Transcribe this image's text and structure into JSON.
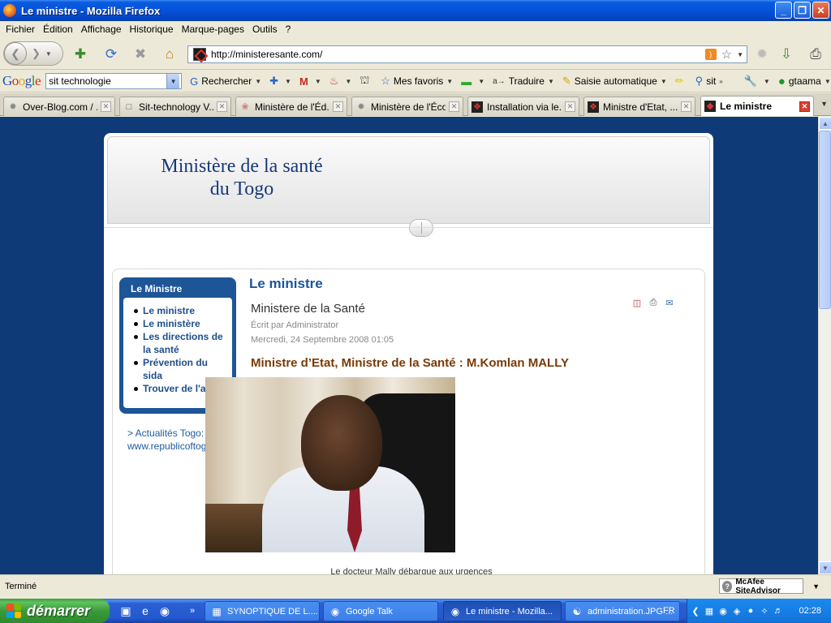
{
  "window": {
    "title": "Le ministre - Mozilla Firefox",
    "minimize": "_",
    "maximize": "❐",
    "close": "✕"
  },
  "menubar": [
    "Fichier",
    "Édition",
    "Affichage",
    "Historique",
    "Marque-pages",
    "Outils",
    "?"
  ],
  "navbar": {
    "url": "http://ministeresante.com/"
  },
  "google_toolbar": {
    "search_value": "sit technologie",
    "items": [
      "Rechercher",
      "Mes favoris",
      "Traduire",
      "Saisie automatique",
      "sit",
      "gtaama"
    ]
  },
  "tabs": [
    {
      "label": "Over-Blog.com / ...",
      "active": false
    },
    {
      "label": "Sit-technology V...",
      "active": false
    },
    {
      "label": "Ministère de l'Éd...",
      "active": false
    },
    {
      "label": "Ministère de l'Éco...",
      "active": false
    },
    {
      "label": "Installation via le...",
      "active": false
    },
    {
      "label": "Ministre d'Etat, ...",
      "active": false
    },
    {
      "label": "Le ministre",
      "active": true
    }
  ],
  "site": {
    "title_line1": "Ministère de la santé",
    "title_line2": "du Togo"
  },
  "sidebar": {
    "title": "Le Ministre",
    "items": [
      "Le ministre",
      "Le ministère",
      "Les directions de la santé",
      "Prévention du sida",
      "Trouver de l'aide"
    ],
    "ext_link_label": "> Actualités Togo:",
    "ext_link_url": "www.republicoftogo.com"
  },
  "article": {
    "section_title": "Le ministre",
    "title": "Ministere de la Santé",
    "author": "Écrit par Administrator",
    "date": "Mercredi, 24 Septembre 2008 01:05",
    "headline": "Ministre d’Etat, Ministre de la Santé : M.Komlan MALLY",
    "caption": "Le docteur Mally débarque aux urgences"
  },
  "statusbar": {
    "text": "Terminé",
    "mcafee": "McAfee SiteAdvisor"
  },
  "taskbar": {
    "start": "démarrer",
    "items": [
      {
        "label": "SYNOPTIQUE DE L....",
        "active": false
      },
      {
        "label": "Google Talk",
        "active": false
      },
      {
        "label": "Le ministre - Mozilla...",
        "active": true
      },
      {
        "label": "administration.JPG ...",
        "active": false
      }
    ],
    "lang": "FR",
    "clock": "02:28"
  }
}
